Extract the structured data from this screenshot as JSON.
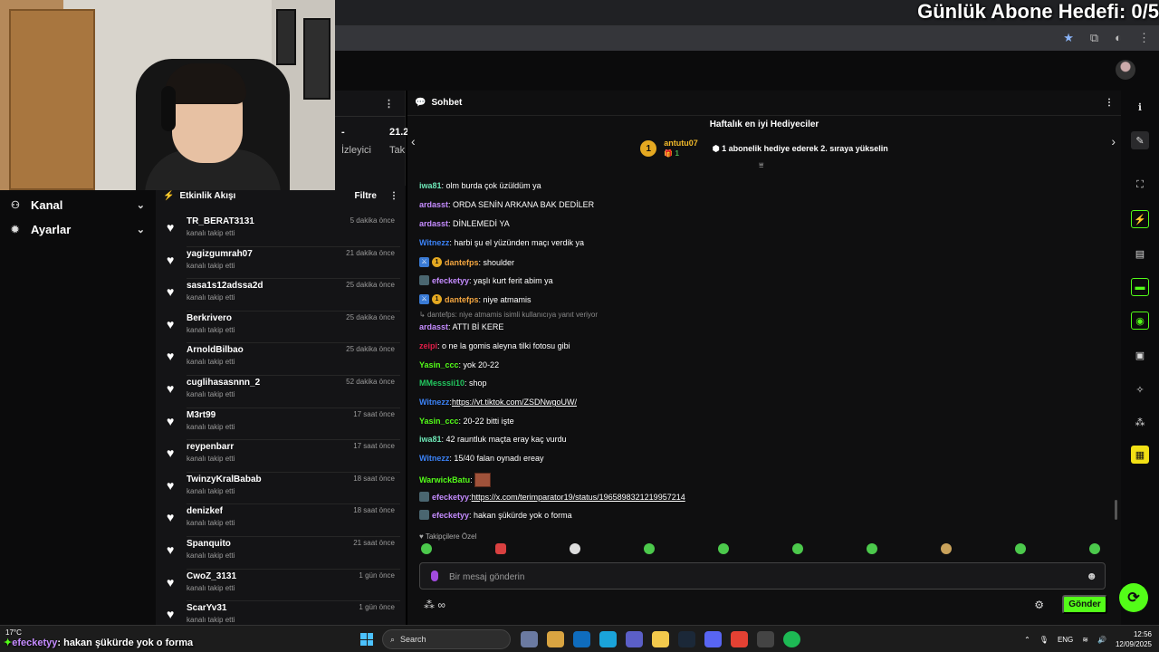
{
  "overlay": {
    "goal_text": "Günlük Abone Hedefi: 0/5",
    "bottom_user": "efecketyy",
    "bottom_msg": ": hakan şükürde yok o forma"
  },
  "leftnav": {
    "items": [
      {
        "label": "Kanal",
        "icon": "channel-icon"
      },
      {
        "label": "Ayarlar",
        "icon": "gear-icon"
      }
    ]
  },
  "stats": {
    "viewers_value": "-",
    "followers_value": "21.2",
    "viewers_label": "İzleyici",
    "followers_label": "Tak"
  },
  "feed": {
    "title": "Etkinlik Akışı",
    "filter_label": "Filtre",
    "items": [
      {
        "user": "TR_BERAT3131",
        "action": "kanalı takip etti",
        "time": "5 dakika önce"
      },
      {
        "user": "yagizgumrah07",
        "action": "kanalı takip etti",
        "time": "21 dakika önce"
      },
      {
        "user": "sasa1s12adssa2d",
        "action": "kanalı takip etti",
        "time": "25 dakika önce"
      },
      {
        "user": "Berkrivero",
        "action": "kanalı takip etti",
        "time": "25 dakika önce"
      },
      {
        "user": "ArnoldBilbao",
        "action": "kanalı takip etti",
        "time": "25 dakika önce"
      },
      {
        "user": "cuglihasasnnn_2",
        "action": "kanalı takip etti",
        "time": "52 dakika önce"
      },
      {
        "user": "M3rt99",
        "action": "kanalı takip etti",
        "time": "17 saat önce"
      },
      {
        "user": "reypenbarr",
        "action": "kanalı takip etti",
        "time": "17 saat önce"
      },
      {
        "user": "TwinzyKralBabab",
        "action": "kanalı takip etti",
        "time": "18 saat önce"
      },
      {
        "user": "denizkef",
        "action": "kanalı takip etti",
        "time": "18 saat önce"
      },
      {
        "user": "Spanquito",
        "action": "kanalı takip etti",
        "time": "21 saat önce"
      },
      {
        "user": "CwoZ_3131",
        "action": "kanalı takip etti",
        "time": "1 gün önce"
      },
      {
        "user": "ScarYv31",
        "action": "kanalı takip etti",
        "time": "1 gün önce"
      }
    ]
  },
  "chat": {
    "title": "Sohbet",
    "gifters_title": "Haftalık en iyi Hediyeciler",
    "top_gifter": {
      "rank": "1",
      "name": "antutu07",
      "count": "1"
    },
    "gift_prompt": "1 abonelik hediye ederek 2. sıraya yükselin",
    "messages": [
      {
        "user": "iwa81",
        "color": "#6ee7b7",
        "text": ": olm burda çok üzüldüm ya"
      },
      {
        "user": "ardasst",
        "color": "#c58cff",
        "text": ": ORDA SENİN ARKANA BAK DEDİLER"
      },
      {
        "user": "ardasst",
        "color": "#c58cff",
        "text": ": DİNLEMEDİ YA"
      },
      {
        "user": "Witnezz",
        "color": "#3b82f6",
        "text": ": harbi şu el yüzünden maçı verdik ya"
      },
      {
        "user": "dantefps",
        "color": "#f4a640",
        "text": ": shoulder"
      },
      {
        "user": "efecketyy",
        "color": "#c58cff",
        "text": ": yaşlı kurt ferit abim ya"
      },
      {
        "user": "dantefps",
        "color": "#f4a640",
        "text": ": niye atmamis"
      },
      {
        "user": "ardasst",
        "color": "#c58cff",
        "text": ": ATTI Bİ KERE"
      },
      {
        "user": "zeipi",
        "color": "#e11d48",
        "text": ": o ne la gomis aleyna tilki fotosu gibi"
      },
      {
        "user": "Yasin_ccc",
        "color": "#53fc18",
        "text": ": yok 20-22"
      },
      {
        "user": "MMesssii10",
        "color": "#22c55e",
        "text": ": shop"
      },
      {
        "user": "Witnezz",
        "color": "#3b82f6",
        "text": ": ",
        "link": "https://vt.tiktok.com/ZSDNwgoUW/"
      },
      {
        "user": "Yasin_ccc",
        "color": "#53fc18",
        "text": ": 20-22 bitti işte"
      },
      {
        "user": "iwa81",
        "color": "#6ee7b7",
        "text": ": 42 rauntluk maçta eray kaç vurdu"
      },
      {
        "user": "Witnezz",
        "color": "#3b82f6",
        "text": ": 15/40 falan oynadı ereay"
      },
      {
        "user": "WarwickBatu",
        "color": "#53fc18",
        "text": ": "
      },
      {
        "user": "efecketyy",
        "color": "#c58cff",
        "text": ": ",
        "link": "https://x.com/terimparator19/status/1965898321219957214"
      },
      {
        "user": "efecketyy",
        "color": "#c58cff",
        "text": ": hakan şükürde yok o forma"
      }
    ],
    "reply_note": "dantefps: niye atmamis isimli kullanıcıya yanıt veriyor",
    "follower_tag": "Takipçilere Özel",
    "input_placeholder": "Bir mesaj gönderin",
    "send_label": "Gönder"
  },
  "taskbar": {
    "weather": "17°C",
    "search_label": "Search",
    "lang": "ENG",
    "time": "12:56",
    "date": "12/09/2025"
  },
  "colors": {
    "accent": "#53fc18",
    "bg": "#0f0f10"
  }
}
